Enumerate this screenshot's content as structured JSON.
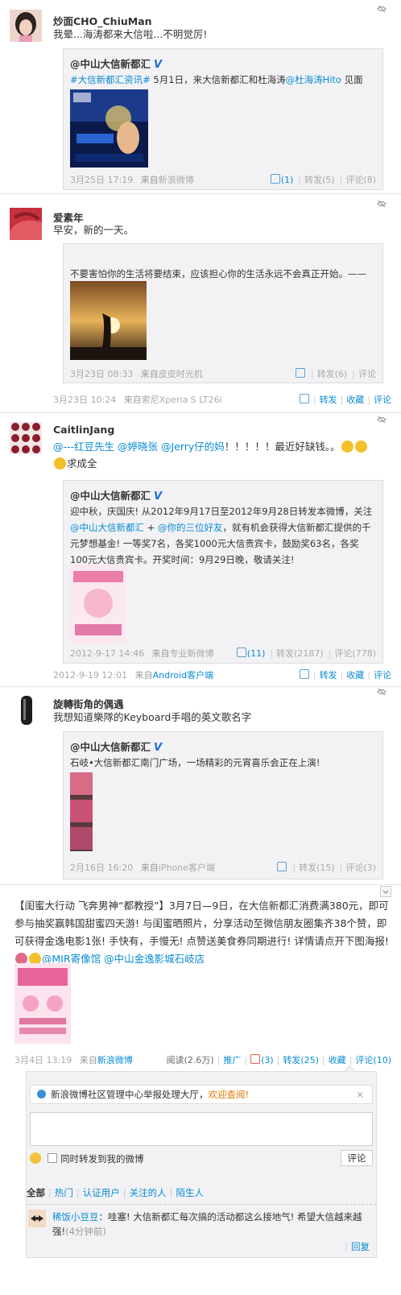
{
  "posts": [
    {
      "user": "炒面CHO_ChiuMan",
      "text": "我晕...海涛都来大信啦...不明觉厉!",
      "fwd": {
        "user": "@中山大信新都汇",
        "text_tag": "#大信新都汇资讯#",
        "text_main": " 5月1日，来大信新都汇和杜海涛",
        "text_mention": "@杜海涛Hito",
        "text_tail": " 见面啦!",
        "time": "3月25日 17:19",
        "from_label": "来自",
        "source": "新浪微博",
        "like": "(1)",
        "forward": "转发(5)",
        "comment": "评论(8)"
      }
    },
    {
      "user": "爱素年",
      "text": "早安，新的一天。",
      "fwd": {
        "text": "不要害怕你的生活将要结束，应该担心你的生活永远不会真正开始。——早安",
        "time": "3月23日 08:33",
        "from_label": "来自",
        "source": "皮皮时光机",
        "forward": "转发(6)",
        "comment": "评论"
      },
      "time": "3月23日 10:24",
      "from_label": "来自",
      "source": "索尼Xperia S LT26i",
      "actions": [
        "转发",
        "收藏",
        "评论"
      ]
    },
    {
      "user": "CaitlinJang",
      "text_mentions": "@---红豆先生 @婷晓张 @Jerry仔的妈",
      "text_tail": "！！！！！最近好缺钱。。",
      "text_tail2": "求成全",
      "fwd": {
        "user": "@中山大信新都汇",
        "text1": "迎中秋，庆国庆! 从2012年9月17日至2012年9月28日转发本微博，关注",
        "mention1": "@中山大信新都汇",
        "plus": " + ",
        "mention2": "@你的三位好友",
        "text2": "，就有机会获得大信新都汇提供的千元梦想基金! 一等奖7名，各奖1000元大信贵宾卡，鼓励奖63名，各奖100元大信贵宾卡。开奖时间：9月29日晚，敬请关注!",
        "time": "2012-9-17 14:46",
        "from_label": "来自",
        "source": "专业新微博",
        "like": "(11)",
        "forward": "转发(2187)",
        "comment": "评论(778)"
      },
      "time": "2012-9-19 12:01",
      "from_label": "来自",
      "source": "Android客户端",
      "actions": [
        "转发",
        "收藏",
        "评论"
      ]
    },
    {
      "user": "旋轉街角的偶遇",
      "text": "我想知道樂隊的Keyboard手唱的英文歌名字",
      "fwd": {
        "user": "@中山大信新都汇",
        "text": "石岐•大信新都汇南门广场，一场精彩的元宵喜乐会正在上演!",
        "time": "2月16日 16:20",
        "from_label": "来自",
        "source": "iPhone客户端",
        "forward": "转发(15)",
        "comment": "评论(3)"
      }
    }
  ],
  "main_post": {
    "text1": "【闺蜜大行动 飞奔男神“都教授”】3月7日—9日，在大信新都汇消费满380元，即可参与抽奖赢韩国甜蜜四天游! 与闺蜜晒照片，分享活动至微信朋友圈集齐38个赞，即可获得金逸电影1张! 手快有，手慢无!  点赞送美食券同期进行! 详情请点开下图海报!",
    "mention1": "@MIR寄像馆",
    "mention2": "@中山金逸影城石岐店",
    "time": "3月4日 13:19",
    "from_label": "来自",
    "source": "新浪微博",
    "read": "阅读(2.6万)",
    "promote": "推广",
    "like": "(3)",
    "forward": "转发(25)",
    "fav": "收藏",
    "comment": "评论(10)"
  },
  "comment_box": {
    "notice_prefix": "新浪微博社区管理中心举报处理大厅，",
    "notice_link": "欢迎查阅!",
    "close": "×",
    "also_forward": "同时转发到我的微博",
    "submit": "评论",
    "filters": [
      "全部",
      "热门",
      "认证用户",
      "关注的人",
      "陌生人"
    ],
    "comment_user": "稀饭小豆豆",
    "comment_text": "：哇塞! 大信新都汇每次搞的活动都这么接地气! 希望大信越来越强!",
    "comment_time": "(4分钟前)",
    "reply": "回复"
  }
}
